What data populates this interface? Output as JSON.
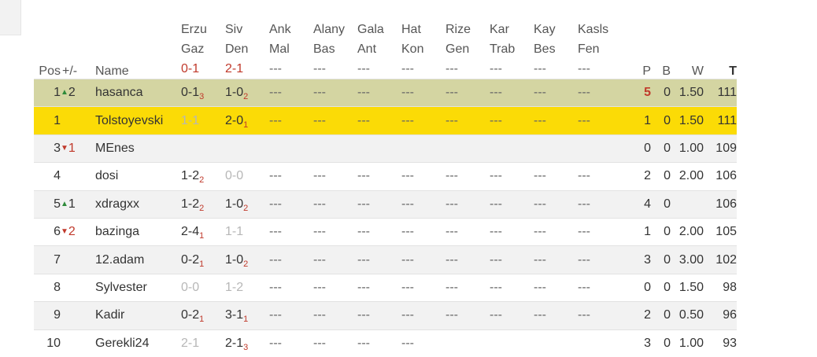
{
  "header": {
    "pos": "Pos",
    "change": "+/-",
    "name": "Name",
    "matches": [
      {
        "home": "Erzu",
        "away": "Gaz",
        "result": "0-1"
      },
      {
        "home": "Siv",
        "away": "Den",
        "result": "2-1"
      },
      {
        "home": "Ank",
        "away": "Mal",
        "result": "---"
      },
      {
        "home": "Alany",
        "away": "Bas",
        "result": "---"
      },
      {
        "home": "Gala",
        "away": "Ant",
        "result": "---"
      },
      {
        "home": "Hat",
        "away": "Kon",
        "result": "---"
      },
      {
        "home": "Rize",
        "away": "Gen",
        "result": "---"
      },
      {
        "home": "Kar",
        "away": "Trab",
        "result": "---"
      },
      {
        "home": "Kay",
        "away": "Bes",
        "result": "---"
      },
      {
        "home": "Kasls",
        "away": "Fen",
        "result": "---"
      }
    ],
    "p": "P",
    "b": "B",
    "w": "W",
    "t": "T"
  },
  "rows": [
    {
      "pos": "1",
      "dir": "up",
      "chg": "2",
      "name": "hasanca",
      "style": "hl-olive",
      "picks": [
        {
          "s": "0-1",
          "sub": "3"
        },
        {
          "s": "1-0",
          "sub": "2"
        },
        {
          "s": "---"
        },
        {
          "s": "---"
        },
        {
          "s": "---"
        },
        {
          "s": "---"
        },
        {
          "s": "---"
        },
        {
          "s": "---"
        },
        {
          "s": "---"
        },
        {
          "s": "---"
        }
      ],
      "p": "5",
      "pbold": true,
      "b": "0",
      "w": "1.50",
      "t": "111"
    },
    {
      "pos": "1",
      "dir": "",
      "chg": "",
      "name": "Tolstoyevski",
      "style": "hl-gold",
      "picks": [
        {
          "s": "1-1",
          "faded": true
        },
        {
          "s": "2-0",
          "sub": "1"
        },
        {
          "s": "---"
        },
        {
          "s": "---"
        },
        {
          "s": "---"
        },
        {
          "s": "---"
        },
        {
          "s": "---"
        },
        {
          "s": "---"
        },
        {
          "s": "---"
        },
        {
          "s": "---"
        }
      ],
      "p": "1",
      "b": "0",
      "w": "1.50",
      "t": "111"
    },
    {
      "pos": "3",
      "dir": "down",
      "chg": "1",
      "name": "MEnes",
      "style": "even",
      "picks": [
        {
          "s": ""
        },
        {
          "s": ""
        },
        {
          "s": ""
        },
        {
          "s": ""
        },
        {
          "s": ""
        },
        {
          "s": ""
        },
        {
          "s": ""
        },
        {
          "s": ""
        },
        {
          "s": ""
        },
        {
          "s": ""
        }
      ],
      "p": "0",
      "b": "0",
      "w": "1.00",
      "t": "109"
    },
    {
      "pos": "4",
      "dir": "",
      "chg": "",
      "name": "dosi",
      "style": "odd",
      "picks": [
        {
          "s": "1-2",
          "sub": "2"
        },
        {
          "s": "0-0",
          "faded": true
        },
        {
          "s": "---"
        },
        {
          "s": "---"
        },
        {
          "s": "---"
        },
        {
          "s": "---"
        },
        {
          "s": "---"
        },
        {
          "s": "---"
        },
        {
          "s": "---"
        },
        {
          "s": "---"
        }
      ],
      "p": "2",
      "b": "0",
      "w": "2.00",
      "t": "106"
    },
    {
      "pos": "5",
      "dir": "up",
      "chg": "1",
      "name": "xdragxx",
      "style": "even",
      "picks": [
        {
          "s": "1-2",
          "sub": "2"
        },
        {
          "s": "1-0",
          "sub": "2"
        },
        {
          "s": "---"
        },
        {
          "s": "---"
        },
        {
          "s": "---"
        },
        {
          "s": "---"
        },
        {
          "s": "---"
        },
        {
          "s": "---"
        },
        {
          "s": "---"
        },
        {
          "s": "---"
        }
      ],
      "p": "4",
      "b": "0",
      "w": "",
      "t": "106"
    },
    {
      "pos": "6",
      "dir": "down",
      "chg": "2",
      "name": "bazinga",
      "style": "odd",
      "picks": [
        {
          "s": "2-4",
          "sub": "1"
        },
        {
          "s": "1-1",
          "faded": true
        },
        {
          "s": "---"
        },
        {
          "s": "---"
        },
        {
          "s": "---"
        },
        {
          "s": "---"
        },
        {
          "s": "---"
        },
        {
          "s": "---"
        },
        {
          "s": "---"
        },
        {
          "s": "---"
        }
      ],
      "p": "1",
      "b": "0",
      "w": "2.00",
      "t": "105"
    },
    {
      "pos": "7",
      "dir": "",
      "chg": "",
      "name": "12.adam",
      "style": "even",
      "picks": [
        {
          "s": "0-2",
          "sub": "1"
        },
        {
          "s": "1-0",
          "sub": "2"
        },
        {
          "s": "---"
        },
        {
          "s": "---"
        },
        {
          "s": "---"
        },
        {
          "s": "---"
        },
        {
          "s": "---"
        },
        {
          "s": "---"
        },
        {
          "s": "---"
        },
        {
          "s": "---"
        }
      ],
      "p": "3",
      "b": "0",
      "w": "3.00",
      "t": "102"
    },
    {
      "pos": "8",
      "dir": "",
      "chg": "",
      "name": "Sylvester",
      "style": "odd",
      "picks": [
        {
          "s": "0-0",
          "faded": true
        },
        {
          "s": "1-2",
          "faded": true
        },
        {
          "s": "---"
        },
        {
          "s": "---"
        },
        {
          "s": "---"
        },
        {
          "s": "---"
        },
        {
          "s": "---"
        },
        {
          "s": "---"
        },
        {
          "s": "---"
        },
        {
          "s": "---"
        }
      ],
      "p": "0",
      "b": "0",
      "w": "1.50",
      "t": "98"
    },
    {
      "pos": "9",
      "dir": "",
      "chg": "",
      "name": "Kadir",
      "style": "even",
      "picks": [
        {
          "s": "0-2",
          "sub": "1"
        },
        {
          "s": "3-1",
          "sub": "1"
        },
        {
          "s": "---"
        },
        {
          "s": "---"
        },
        {
          "s": "---"
        },
        {
          "s": "---"
        },
        {
          "s": "---"
        },
        {
          "s": "---"
        },
        {
          "s": "---"
        },
        {
          "s": "---"
        }
      ],
      "p": "2",
      "b": "0",
      "w": "0.50",
      "t": "96"
    },
    {
      "pos": "10",
      "dir": "",
      "chg": "",
      "name": "Gerekli24",
      "style": "odd",
      "picks": [
        {
          "s": "2-1",
          "faded": true
        },
        {
          "s": "2-1",
          "sub": "3"
        },
        {
          "s": "---"
        },
        {
          "s": "---"
        },
        {
          "s": "---"
        },
        {
          "s": "---"
        },
        {
          "s": ""
        },
        {
          "s": ""
        },
        {
          "s": ""
        },
        {
          "s": ""
        }
      ],
      "p": "3",
      "b": "0",
      "w": "1.00",
      "t": "93"
    }
  ],
  "icons": {
    "up": "triangle-up-icon",
    "down": "triangle-down-icon"
  },
  "colors": {
    "olive_row": "#d4d5a2",
    "gold_row": "#fbdb06",
    "up": "#2e8b3a",
    "down": "#c0392b"
  }
}
